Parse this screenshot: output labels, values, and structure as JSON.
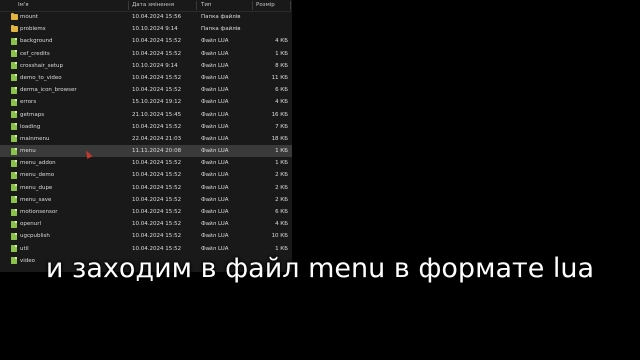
{
  "columns": {
    "name": "Ім'я",
    "date": "Дата змінення",
    "type": "Тип",
    "size": "Розмір"
  },
  "files": [
    {
      "name": "mount",
      "date": "10.04.2024 15:56",
      "type": "Папка файлів",
      "size": "",
      "icon": "folder-icon",
      "selected": false
    },
    {
      "name": "problems",
      "date": "10.10.2024 9:14",
      "type": "Папка файлів",
      "size": "",
      "icon": "folder-icon",
      "selected": false
    },
    {
      "name": "background",
      "date": "10.04.2024 15:52",
      "type": "Файл LUA",
      "size": "4 КБ",
      "icon": "lua-file-icon",
      "selected": false
    },
    {
      "name": "cef_credits",
      "date": "10.04.2024 15:52",
      "type": "Файл LUA",
      "size": "1 КБ",
      "icon": "lua-file-icon",
      "selected": false
    },
    {
      "name": "crosshair_setup",
      "date": "10.10.2024 9:14",
      "type": "Файл LUA",
      "size": "8 КБ",
      "icon": "lua-file-icon",
      "selected": false
    },
    {
      "name": "demo_to_video",
      "date": "10.04.2024 15:52",
      "type": "Файл LUA",
      "size": "11 КБ",
      "icon": "lua-file-icon",
      "selected": false
    },
    {
      "name": "derma_icon_browser",
      "date": "10.04.2024 15:52",
      "type": "Файл LUA",
      "size": "6 КБ",
      "icon": "lua-file-icon",
      "selected": false
    },
    {
      "name": "errors",
      "date": "15.10.2024 19:12",
      "type": "Файл LUA",
      "size": "4 КБ",
      "icon": "lua-file-icon",
      "selected": false
    },
    {
      "name": "getmaps",
      "date": "21.10.2024 15:45",
      "type": "Файл LUA",
      "size": "16 КБ",
      "icon": "lua-file-icon",
      "selected": false
    },
    {
      "name": "loading",
      "date": "10.04.2024 15:52",
      "type": "Файл LUA",
      "size": "7 КБ",
      "icon": "lua-file-icon",
      "selected": false
    },
    {
      "name": "mainmenu",
      "date": "22.04.2024 21:03",
      "type": "Файл LUA",
      "size": "18 КБ",
      "icon": "lua-file-icon",
      "selected": false
    },
    {
      "name": "menu",
      "date": "11.11.2024 20:08",
      "type": "Файл LUA",
      "size": "1 КБ",
      "icon": "lua-file-icon",
      "selected": true
    },
    {
      "name": "menu_addon",
      "date": "10.04.2024 15:52",
      "type": "Файл LUA",
      "size": "1 КБ",
      "icon": "lua-file-icon",
      "selected": false
    },
    {
      "name": "menu_demo",
      "date": "10.04.2024 15:52",
      "type": "Файл LUA",
      "size": "2 КБ",
      "icon": "lua-file-icon",
      "selected": false
    },
    {
      "name": "menu_dupe",
      "date": "10.04.2024 15:52",
      "type": "Файл LUA",
      "size": "2 КБ",
      "icon": "lua-file-icon",
      "selected": false
    },
    {
      "name": "menu_save",
      "date": "10.04.2024 15:52",
      "type": "Файл LUA",
      "size": "2 КБ",
      "icon": "lua-file-icon",
      "selected": false
    },
    {
      "name": "motionsensor",
      "date": "10.04.2024 15:52",
      "type": "Файл LUA",
      "size": "6 КБ",
      "icon": "lua-file-icon",
      "selected": false
    },
    {
      "name": "openurl",
      "date": "10.04.2024 15:52",
      "type": "Файл LUA",
      "size": "4 КБ",
      "icon": "lua-file-icon",
      "selected": false
    },
    {
      "name": "ugcpublish",
      "date": "10.04.2024 15:52",
      "type": "Файл LUA",
      "size": "10 КБ",
      "icon": "lua-file-icon",
      "selected": false
    },
    {
      "name": "util",
      "date": "10.04.2024 15:52",
      "type": "Файл LUA",
      "size": "1 КБ",
      "icon": "lua-file-icon",
      "selected": false
    },
    {
      "name": "video",
      "date": "",
      "type": "",
      "size": "",
      "icon": "lua-file-icon",
      "selected": false
    }
  ],
  "caption": "и заходим в файл menu в формате lua",
  "colors": {
    "background": "#000000",
    "pane": "#191919",
    "selected_row": "#3a3a3a",
    "folder": "#e3b341",
    "lua_file": "#8bc34a",
    "caption_text": "#ffffff"
  }
}
